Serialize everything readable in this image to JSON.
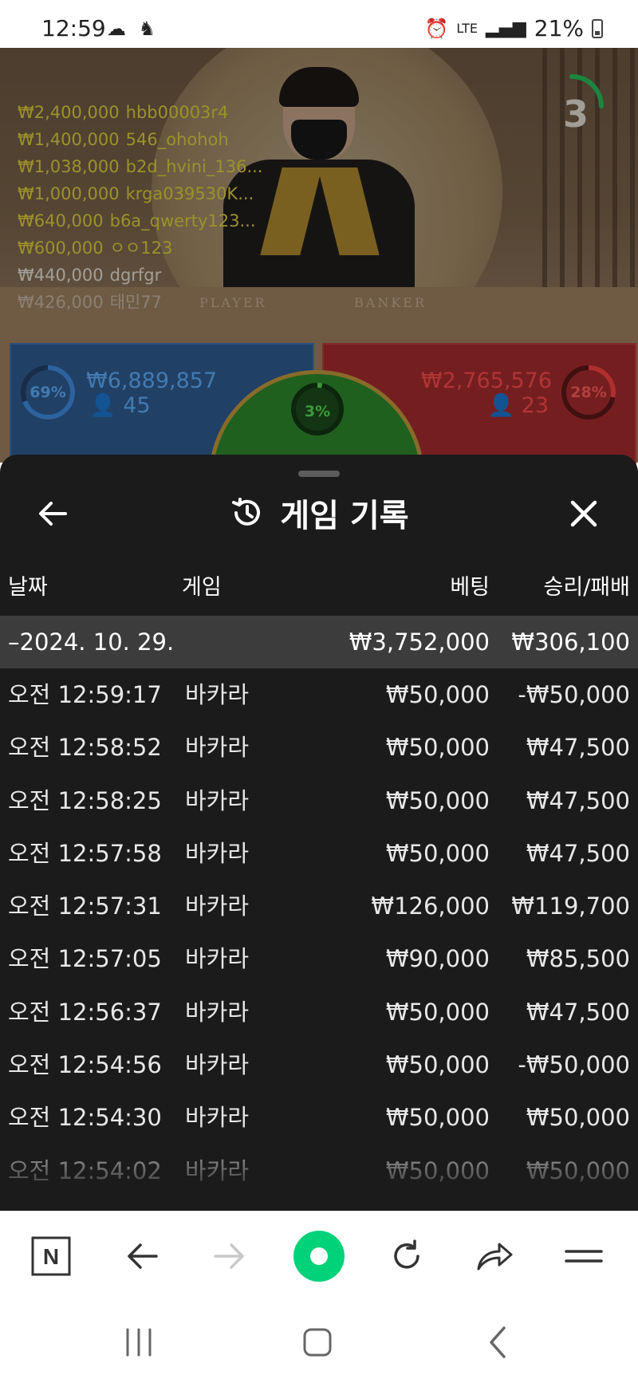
{
  "status_bar": {
    "time": "12:59",
    "left_icons": "☁ ♞",
    "network": "LTE",
    "battery": "21%"
  },
  "video": {
    "countdown": "3",
    "table_player_label": "PLAYER",
    "table_banker_label": "BANKER",
    "bet_feed": [
      {
        "amount": "₩2,400,000",
        "user": "hbb00003r4"
      },
      {
        "amount": "₩1,400,000",
        "user": "546_ohohoh"
      },
      {
        "amount": "₩1,038,000",
        "user": "b2d_hvini_136..."
      },
      {
        "amount": "₩1,000,000",
        "user": "krga039530K..."
      },
      {
        "amount": "₩640,000",
        "user": "b6a_qwerty123..."
      },
      {
        "amount": "₩600,000",
        "user": "ㅇㅇ123"
      },
      {
        "amount": "₩440,000",
        "user": "dgrfgr"
      },
      {
        "amount": "₩426,000",
        "user": "태민77"
      }
    ],
    "player": {
      "percent": "69%",
      "percent_value": 0.69,
      "amount": "₩6,889,857",
      "count": "45"
    },
    "banker": {
      "percent": "28%",
      "percent_value": 0.28,
      "amount": "₩2,765,576",
      "count": "23"
    },
    "tie": {
      "percent": "3%",
      "percent_value": 0.03
    }
  },
  "history": {
    "title": "게임 기록",
    "columns": {
      "date": "날짜",
      "game": "게임",
      "bet": "베팅",
      "win": "승리/패배"
    },
    "group": {
      "date": "–2024. 10. 29.",
      "bet_total": "₩3,752,000",
      "win_total": "₩306,100"
    },
    "rows": [
      {
        "time": "오전 12:59:17",
        "game": "바카라",
        "bet": "₩50,000",
        "result": "-₩50,000"
      },
      {
        "time": "오전 12:58:52",
        "game": "바카라",
        "bet": "₩50,000",
        "result": "₩47,500"
      },
      {
        "time": "오전 12:58:25",
        "game": "바카라",
        "bet": "₩50,000",
        "result": "₩47,500"
      },
      {
        "time": "오전 12:57:58",
        "game": "바카라",
        "bet": "₩50,000",
        "result": "₩47,500"
      },
      {
        "time": "오전 12:57:31",
        "game": "바카라",
        "bet": "₩126,000",
        "result": "₩119,700"
      },
      {
        "time": "오전 12:57:05",
        "game": "바카라",
        "bet": "₩90,000",
        "result": "₩85,500"
      },
      {
        "time": "오전 12:56:37",
        "game": "바카라",
        "bet": "₩50,000",
        "result": "₩47,500"
      },
      {
        "time": "오전 12:54:56",
        "game": "바카라",
        "bet": "₩50,000",
        "result": "-₩50,000"
      },
      {
        "time": "오전 12:54:30",
        "game": "바카라",
        "bet": "₩50,000",
        "result": "₩50,000"
      },
      {
        "time": "오전 12:54:02",
        "game": "바카라",
        "bet": "₩50,000",
        "result": "₩50,000"
      }
    ]
  },
  "toolbar": {
    "home_label": "N",
    "icons": [
      "naver-home-icon",
      "back-arrow-icon",
      "forward-arrow-icon",
      "green-dot-icon",
      "refresh-icon",
      "share-icon",
      "menu-icon"
    ]
  },
  "colors": {
    "sheet_bg": "#1b1b1b",
    "group_bg": "#3c3c3c",
    "player_blue": "#5fb0ff",
    "banker_red": "#ff4a4a",
    "tie_green": "#55dd55",
    "feed_yellow": "#e2d23c",
    "accent_green": "#00d27a"
  }
}
